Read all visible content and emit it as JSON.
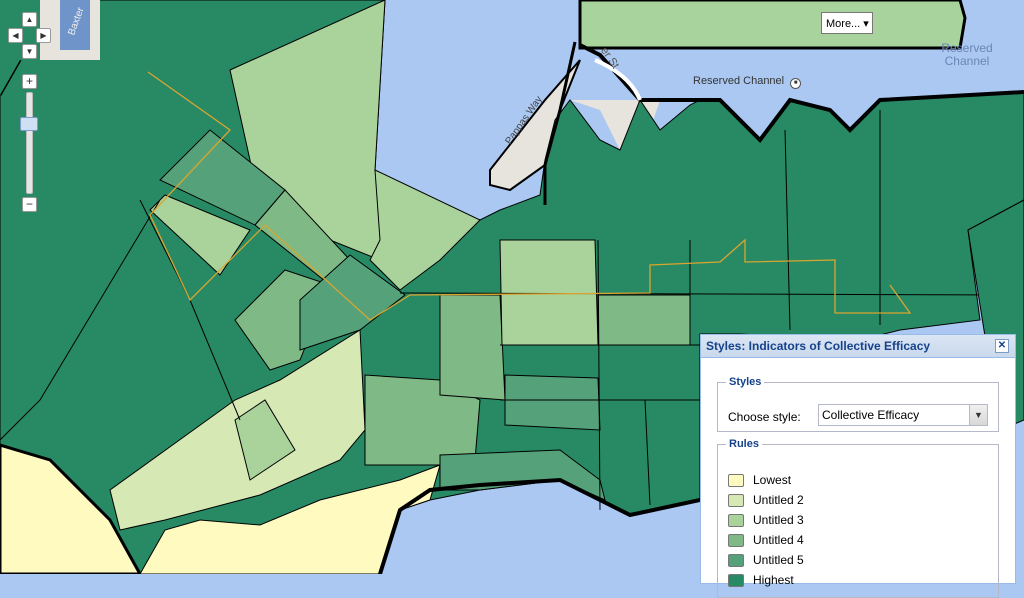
{
  "map": {
    "water_label": "Reserved\nChannel",
    "poi_label": "Reserved Channel",
    "street_labels": [
      "er St",
      "Pappas Way",
      "Baxter"
    ],
    "colors": {
      "water": "#aac8f2",
      "lowest": "#fffac0",
      "untitled2": "#d6e8b4",
      "untitled3": "#aad39b",
      "untitled4": "#7fba86",
      "untitled5": "#55a27a",
      "highest": "#278a64",
      "route": "#d9a530"
    }
  },
  "controls": {
    "zoom_in": "+",
    "zoom_out": "−",
    "more_button": "More... ▾"
  },
  "panel": {
    "title": "Styles: Indicators of Collective Efficacy",
    "styles_legend": "Styles",
    "choose_label": "Choose style:",
    "selected_style": "Collective Efficacy",
    "rules_legend": "Rules",
    "rules": [
      {
        "label": "Lowest",
        "color": "#fffac0"
      },
      {
        "label": "Untitled 2",
        "color": "#d6e8b4"
      },
      {
        "label": "Untitled 3",
        "color": "#aad39b"
      },
      {
        "label": "Untitled 4",
        "color": "#7fba86"
      },
      {
        "label": "Untitled 5",
        "color": "#55a27a"
      },
      {
        "label": "Highest",
        "color": "#278a64"
      }
    ]
  }
}
